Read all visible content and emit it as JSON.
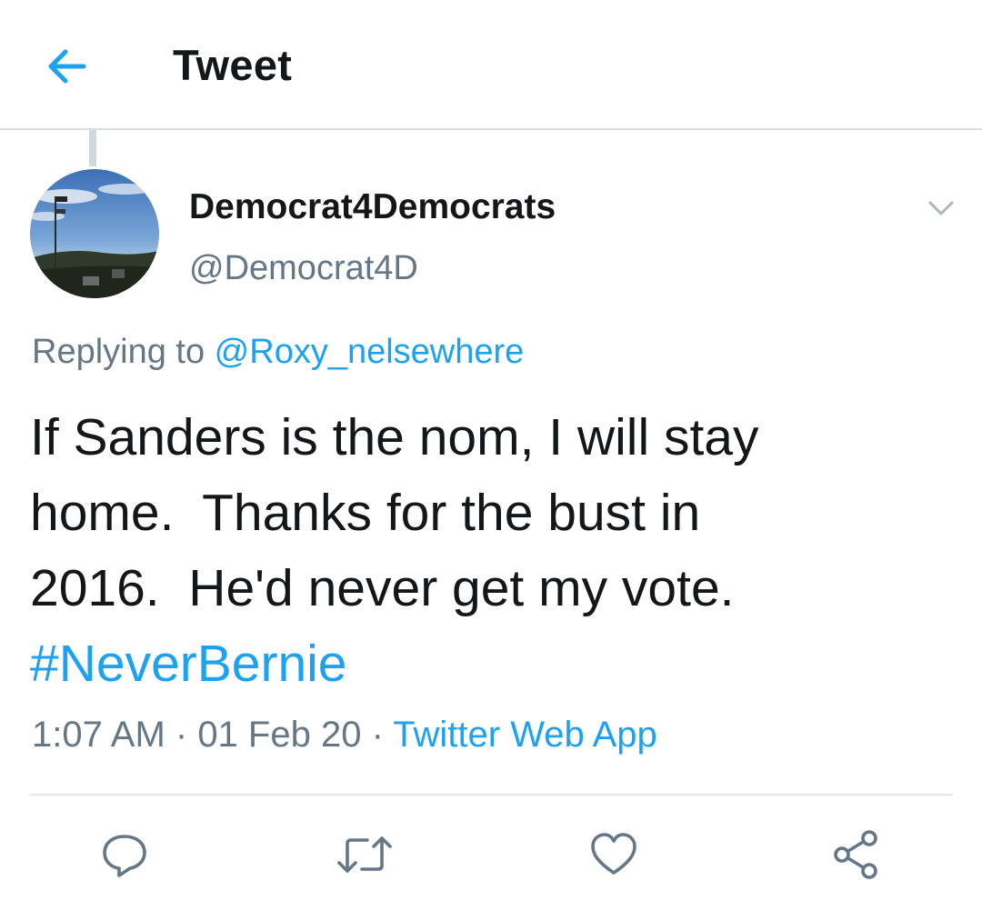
{
  "header": {
    "title": "Tweet",
    "back_icon": "arrow-left-icon"
  },
  "colors": {
    "accent": "#1da1f2",
    "secondary_text": "#657786",
    "primary_text": "#14171a",
    "divider": "#e1e8ed"
  },
  "tweet": {
    "display_name": "Democrat4Democrats",
    "handle": "@Democrat4D",
    "replying_prefix": "Replying to ",
    "replying_to": "@Roxy_nelsewhere",
    "text_line1": "If Sanders is the nom, I will stay",
    "text_line2": "home.  Thanks for the bust in",
    "text_line3": "2016.  He'd never get my vote.",
    "hashtag": "#NeverBernie",
    "time": "1:07 AM",
    "separator": " · ",
    "date": "01 Feb 20",
    "source": "Twitter Web App"
  },
  "actions": [
    {
      "name": "reply",
      "icon": "reply-icon"
    },
    {
      "name": "retweet",
      "icon": "retweet-icon"
    },
    {
      "name": "like",
      "icon": "heart-icon"
    },
    {
      "name": "share",
      "icon": "share-icon"
    }
  ]
}
